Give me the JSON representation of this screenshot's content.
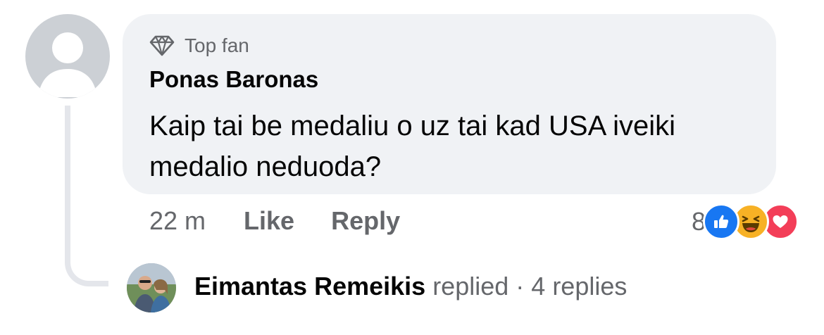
{
  "comment": {
    "badge_label": "Top fan",
    "badge_icon": "diamond-icon",
    "author": "Ponas Baronas",
    "text": "Kaip tai be medaliu o uz tai kad USA iveiki medalio neduoda?",
    "timestamp": "22 m",
    "like_label": "Like",
    "reply_label": "Reply",
    "reaction_count": "8",
    "reactions": [
      "like",
      "haha",
      "love"
    ]
  },
  "replies_summary": {
    "name": "Eimantas Remeikis",
    "action": "replied",
    "separator": "·",
    "count_label": "4 replies"
  },
  "colors": {
    "bubble_bg": "#f0f2f5",
    "secondary_text": "#65676b",
    "like_blue": "#1877f2",
    "haha_yellow": "#f7b125",
    "love_red": "#f33e58"
  }
}
